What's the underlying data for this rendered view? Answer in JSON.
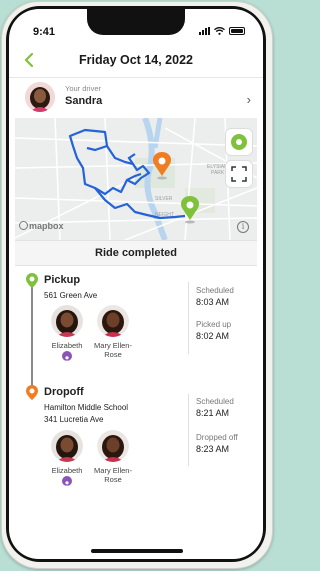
{
  "status_bar": {
    "time": "9:41"
  },
  "header": {
    "title": "Friday Oct 14, 2022"
  },
  "driver": {
    "caption": "Your driver",
    "name": "Sandra"
  },
  "map": {
    "attribution": "mapbox",
    "info": "i"
  },
  "ride_status": "Ride completed",
  "pickup": {
    "title": "Pickup",
    "address": "561 Green Ave",
    "scheduled_label": "Scheduled",
    "scheduled_time": "8:03 AM",
    "actual_label": "Picked up",
    "actual_time": "8:02 AM",
    "passengers": [
      {
        "name": "Elizabeth",
        "badge": true
      },
      {
        "name": "Mary Ellen-Rose",
        "badge": false
      }
    ]
  },
  "dropoff": {
    "title": "Dropoff",
    "address_line1": "Hamilton Middle School",
    "address_line2": "341 Lucretia Ave",
    "scheduled_label": "Scheduled",
    "scheduled_time": "8:21 AM",
    "actual_label": "Dropped off",
    "actual_time": "8:23 AM",
    "passengers": [
      {
        "name": "Elizabeth",
        "badge": true
      },
      {
        "name": "Mary Ellen-Rose",
        "badge": false
      }
    ]
  },
  "colors": {
    "pickup_green": "#7fc13c",
    "dropoff_orange": "#f07d22",
    "route_blue": "#2563d8",
    "badge_purple": "#8a55b5",
    "background_mint": "#b9dfd4"
  }
}
